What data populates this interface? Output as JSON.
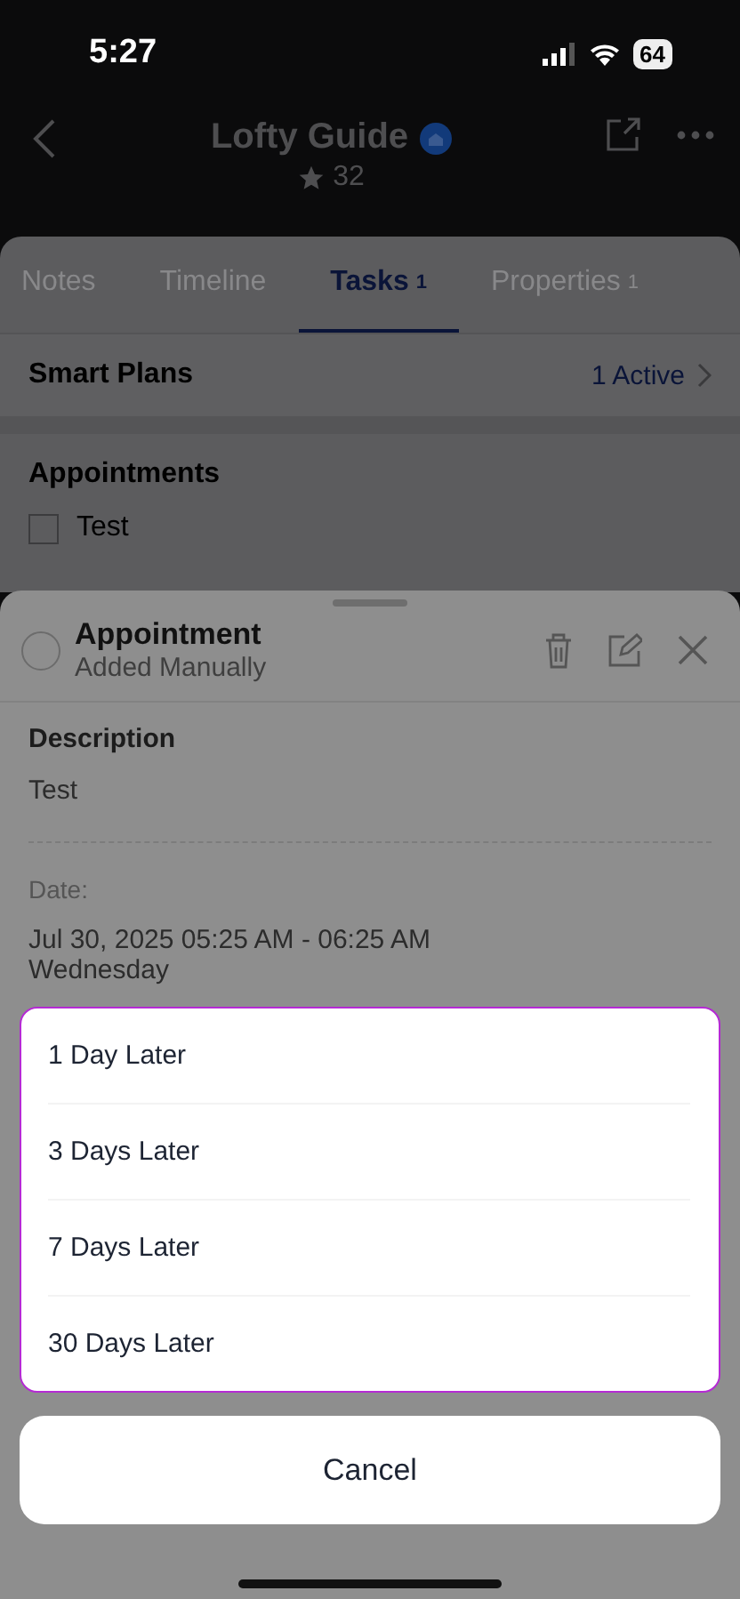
{
  "status_bar": {
    "time": "5:27",
    "battery": "64"
  },
  "header": {
    "title": "Lofty Guide",
    "stars": "32"
  },
  "tabs": [
    {
      "label": "Notes",
      "selected": false
    },
    {
      "label": "Timeline",
      "selected": false
    },
    {
      "label": "Tasks",
      "count": "1",
      "selected": true
    },
    {
      "label": "Properties",
      "count": "1",
      "selected": false
    }
  ],
  "smart_plans": {
    "label": "Smart Plans",
    "value": "1 Active"
  },
  "appointments": {
    "title": "Appointments",
    "items": [
      {
        "label": "Test",
        "checked": false
      }
    ]
  },
  "detail_sheet": {
    "title": "Appointment",
    "subtitle": "Added Manually",
    "done": false,
    "description_label": "Description",
    "description": "Test",
    "date_label": "Date:",
    "date": "Jul 30, 2025 05:25 AM - 06:25 AM",
    "weekday": "Wednesday"
  },
  "action_sheet": {
    "options": [
      "1 Day Later",
      "3 Days Later",
      "7 Days Later",
      "30 Days Later"
    ],
    "cancel": "Cancel"
  }
}
